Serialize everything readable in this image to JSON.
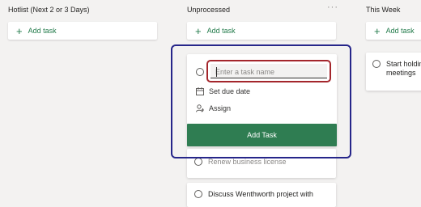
{
  "columns": [
    {
      "title": "Hotlist (Next 2 or 3 Days)",
      "add_label": "Add task"
    },
    {
      "title": "Unprocessed",
      "add_label": "Add task",
      "more_icon": "ellipsis-icon"
    },
    {
      "title": "This Week",
      "add_label": "Add task"
    }
  ],
  "new_task_form": {
    "placeholder": "Enter a task name",
    "due_date_label": "Set due date",
    "assign_label": "Assign",
    "submit_label": "Add Task"
  },
  "tasks": {
    "unprocessed": [
      "Renew business license",
      "Discuss Wenthworth project with"
    ],
    "this_week": [
      "Start holdin",
      "meetings"
    ]
  },
  "colors": {
    "accent_green": "#2f7d52",
    "focus_outline": "#26268a",
    "input_border": "#a4262c",
    "background": "#f3f2f1"
  }
}
